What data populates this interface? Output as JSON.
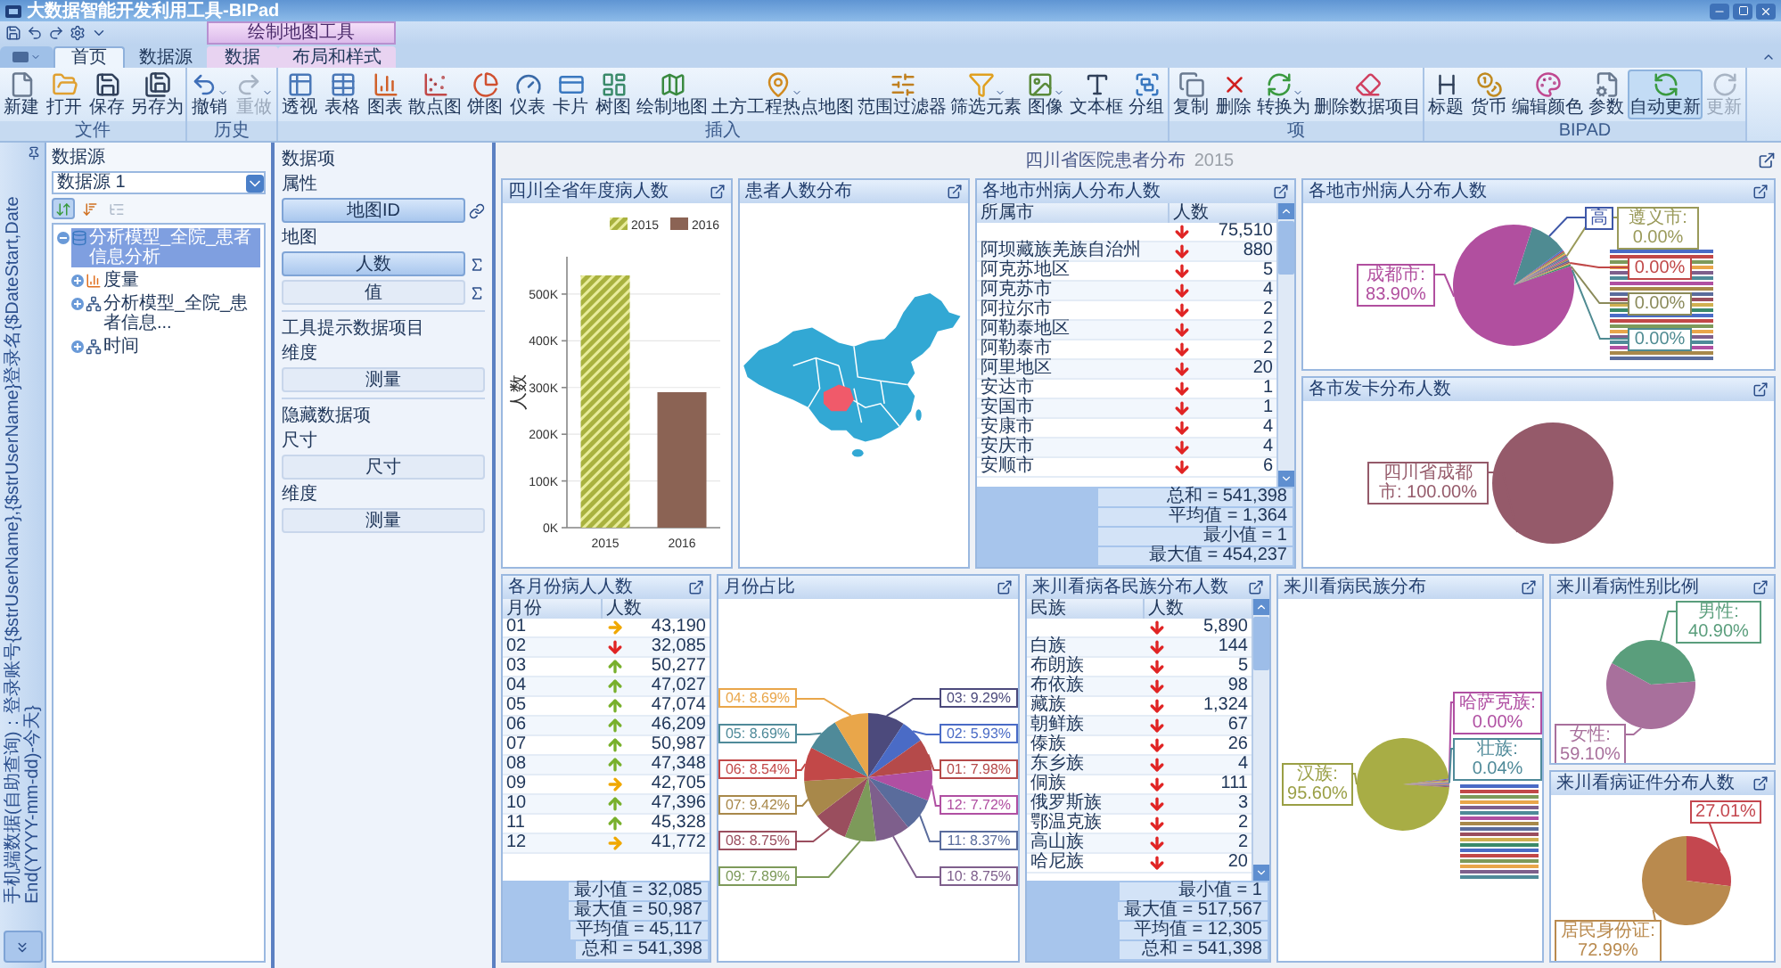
{
  "window": {
    "title": "大数据智能开发利用工具-BIPad"
  },
  "contextual_group": {
    "label": "绘制地图工具"
  },
  "tabs": [
    {
      "label": "首页",
      "selected": true,
      "contextual": false
    },
    {
      "label": "数据源",
      "selected": false,
      "contextual": false
    },
    {
      "label": "数据",
      "selected": false,
      "contextual": true
    },
    {
      "label": "布局和样式",
      "selected": false,
      "contextual": true
    }
  ],
  "ribbon": [
    {
      "label": "文件",
      "buttons": [
        {
          "label": "新建",
          "disabled": false,
          "on": false,
          "menu": false
        },
        {
          "label": "打开",
          "disabled": false,
          "on": false,
          "menu": false
        },
        {
          "label": "保存",
          "disabled": false,
          "on": false,
          "menu": false
        },
        {
          "label": "另存为",
          "disabled": false,
          "on": false,
          "menu": false
        }
      ]
    },
    {
      "label": "历史",
      "buttons": [
        {
          "label": "撤销",
          "disabled": false,
          "on": false,
          "menu": true
        },
        {
          "label": "重做",
          "disabled": true,
          "on": false,
          "menu": true
        }
      ]
    },
    {
      "label": "插入",
      "buttons": [
        {
          "label": "透视",
          "disabled": false,
          "on": false,
          "menu": false
        },
        {
          "label": "表格",
          "disabled": false,
          "on": false,
          "menu": false
        },
        {
          "label": "图表",
          "disabled": false,
          "on": false,
          "menu": false
        },
        {
          "label": "散点图",
          "disabled": false,
          "on": false,
          "menu": false
        },
        {
          "label": "饼图",
          "disabled": false,
          "on": false,
          "menu": false
        },
        {
          "label": "仪表",
          "disabled": false,
          "on": false,
          "menu": false
        },
        {
          "label": "卡片",
          "disabled": false,
          "on": false,
          "menu": false
        },
        {
          "label": "树图",
          "disabled": false,
          "on": false,
          "menu": false
        },
        {
          "label": "绘制地图",
          "disabled": false,
          "on": false,
          "menu": false
        },
        {
          "label": "土方工程热点地图",
          "disabled": false,
          "on": false,
          "menu": true
        },
        {
          "label": "范围过滤器",
          "disabled": false,
          "on": false,
          "menu": false
        },
        {
          "label": "筛选元素",
          "disabled": false,
          "on": false,
          "menu": true
        },
        {
          "label": "图像",
          "disabled": false,
          "on": false,
          "menu": true
        },
        {
          "label": "文本框",
          "disabled": false,
          "on": false,
          "menu": false
        },
        {
          "label": "分组",
          "disabled": false,
          "on": false,
          "menu": false
        }
      ]
    },
    {
      "label": "项",
      "buttons": [
        {
          "label": "复制",
          "disabled": false,
          "on": false,
          "menu": false
        },
        {
          "label": "删除",
          "disabled": false,
          "on": false,
          "menu": false
        },
        {
          "label": "转换为",
          "disabled": false,
          "on": false,
          "menu": true
        },
        {
          "label": "删除数据项目",
          "disabled": false,
          "on": false,
          "menu": false
        }
      ]
    },
    {
      "label": "BIPAD",
      "buttons": [
        {
          "label": "标题",
          "disabled": false,
          "on": false,
          "menu": false
        },
        {
          "label": "货币",
          "disabled": false,
          "on": false,
          "menu": false
        },
        {
          "label": "编辑颜色",
          "disabled": false,
          "on": false,
          "menu": false
        },
        {
          "label": "参数",
          "disabled": false,
          "on": false,
          "menu": false
        },
        {
          "label": "自动更新",
          "disabled": false,
          "on": true,
          "menu": false
        },
        {
          "label": "更新",
          "disabled": true,
          "on": false,
          "menu": false
        }
      ]
    }
  ],
  "side_strip": {
    "text": "手机端数据(自助查询)：登录账号{$strUserName},{$strUserName}登录名{$DateStart,DateEnd(YYYY-mm-dd)-今天}"
  },
  "data_source": {
    "label": "数据源",
    "value": "数据源 1",
    "toolbar": [
      {
        "selected": true,
        "disabled": false
      },
      {
        "selected": false,
        "disabled": false
      },
      {
        "selected": false,
        "disabled": true
      }
    ],
    "tree": [
      {
        "label": "分析模型_全院_患者信息分析",
        "kind": "source",
        "selected": true,
        "expanded": true,
        "children": [
          {
            "label": "度量",
            "kind": "measure",
            "selected": false,
            "expanded": false
          },
          {
            "label": "分析模型_全院_患者信息...",
            "kind": "dimension",
            "selected": false,
            "expanded": false
          },
          {
            "label": "时间",
            "kind": "dimension",
            "selected": false,
            "expanded": false
          }
        ]
      }
    ]
  },
  "data_items": {
    "groups": [
      {
        "title": "数据项",
        "sections": [
          {
            "label": "属性",
            "slots": [
              {
                "label": "地图ID",
                "filled": true,
                "kind": "link"
              }
            ]
          },
          {
            "label": "地图",
            "slots": [
              {
                "label": "人数",
                "filled": true,
                "kind": "sum"
              },
              {
                "label": "值",
                "filled": false,
                "kind": "sum"
              }
            ]
          }
        ]
      },
      {
        "title": "工具提示数据项目",
        "sections": [
          {
            "label": "维度",
            "slots": [
              {
                "label": "测量",
                "filled": false,
                "kind": "plain"
              }
            ]
          }
        ]
      },
      {
        "title": "隐藏数据项",
        "sections": [
          {
            "label": "尺寸",
            "slots": [
              {
                "label": "尺寸",
                "filled": false,
                "kind": "plain"
              }
            ]
          },
          {
            "label": "维度",
            "slots": [
              {
                "label": "测量",
                "filled": false,
                "kind": "plain"
              }
            ]
          }
        ]
      }
    ]
  },
  "dashboard": {
    "title": "四川省医院患者分布",
    "subtitle": "2015",
    "rows": [
      {
        "columns": [
          [
            {
              "kind": "chart",
              "title": "四川全省年度病人数",
              "chart_data": {
                "type": "bar",
                "categories": [
                  "2015",
                  "2016"
                ],
                "ylabel": "人数",
                "ylim": [
                  0,
                  580000
                ],
                "grid": true,
                "legend": "top",
                "yticks": [
                  {
                    "value": 0,
                    "label": "0K"
                  },
                  {
                    "value": 100000,
                    "label": "100K"
                  },
                  {
                    "value": 200000,
                    "label": "200K"
                  },
                  {
                    "value": 300000,
                    "label": "300K"
                  },
                  {
                    "value": 400000,
                    "label": "400K"
                  },
                  {
                    "value": 500000,
                    "label": "500K"
                  }
                ],
                "series": [
                  {
                    "name": "2015",
                    "color": "#a9b23f",
                    "values": [
                      540000,
                      null
                    ]
                  },
                  {
                    "name": "2016",
                    "color": "#8b6354",
                    "values": [
                      null,
                      290000
                    ]
                  }
                ]
              }
            }
          ],
          [
            {
              "kind": "map",
              "title": "患者人数分布"
            }
          ],
          [
            {
              "kind": "grid",
              "title": "各地市州病人分布人数",
              "scrollable": true,
              "columns": [
                "所属市",
                "人数"
              ],
              "rows": [
                {
                  "value": "75,510",
                  "kind": "down"
                },
                {
                  "name": "阿坝藏族羌族自治州",
                  "value": "880",
                  "kind": "down"
                },
                {
                  "name": "阿克苏地区",
                  "value": "5",
                  "kind": "down"
                },
                {
                  "name": "阿克苏市",
                  "value": "4",
                  "kind": "down"
                },
                {
                  "name": "阿拉尔市",
                  "value": "2",
                  "kind": "down"
                },
                {
                  "name": "阿勒泰地区",
                  "value": "2",
                  "kind": "down"
                },
                {
                  "name": "阿勒泰市",
                  "value": "2",
                  "kind": "down"
                },
                {
                  "name": "阿里地区",
                  "value": "20",
                  "kind": "down"
                },
                {
                  "name": "安达市",
                  "value": "1",
                  "kind": "down"
                },
                {
                  "name": "安国市",
                  "value": "1",
                  "kind": "down"
                },
                {
                  "name": "安康市",
                  "value": "4",
                  "kind": "down"
                },
                {
                  "name": "安庆市",
                  "value": "4",
                  "kind": "down"
                },
                {
                  "name": "安顺市",
                  "value": "6",
                  "kind": "down"
                }
              ],
              "totals": [
                "总和 = 541,398",
                "平均值 = 1,364",
                "最小值 = 1",
                "最大值 = 454,237"
              ]
            }
          ],
          [
            {
              "kind": "pie_drawing",
              "title": "各地市州病人分布人数",
              "labels": [
                {
                  "text": "成都市: 83.90%",
                  "color": "#b14f9f"
                },
                {
                  "text": "高",
                  "color": "#3f58a8"
                },
                {
                  "text": "遵义市: 0.00%",
                  "color": "#9a9a5a"
                },
                {
                  "text": "0.00%",
                  "color": "#c04848"
                },
                {
                  "text": "0.00%",
                  "color": "#8a8a5a"
                },
                {
                  "text": "0.00%",
                  "color": "#4f8b92"
                }
              ]
            },
            {
              "kind": "chart",
              "title": "各市发卡分布人数",
              "chart_data": {
                "type": "pie",
                "values": [
                  100
                ],
                "colors": [
                  "#955a6a"
                ],
                "value_labels": [
                  "四川省成都市: 100.00%"
                ]
              }
            }
          ]
        ]
      },
      {
        "columns": [
          [
            {
              "kind": "grid",
              "title": "各月份病人人数",
              "scrollable": false,
              "columns": [
                "月份",
                "人数"
              ],
              "rows": [
                {
                  "name": "01",
                  "value": "43,190",
                  "kind": "flat"
                },
                {
                  "name": "02",
                  "value": "32,085",
                  "kind": "down"
                },
                {
                  "name": "03",
                  "value": "50,277",
                  "kind": "up"
                },
                {
                  "name": "04",
                  "value": "47,027",
                  "kind": "up"
                },
                {
                  "name": "05",
                  "value": "47,074",
                  "kind": "up"
                },
                {
                  "name": "06",
                  "value": "46,209",
                  "kind": "up"
                },
                {
                  "name": "07",
                  "value": "50,987",
                  "kind": "up"
                },
                {
                  "name": "08",
                  "value": "47,348",
                  "kind": "up"
                },
                {
                  "name": "09",
                  "value": "42,705",
                  "kind": "flat"
                },
                {
                  "name": "10",
                  "value": "47,396",
                  "kind": "up"
                },
                {
                  "name": "11",
                  "value": "45,328",
                  "kind": "up"
                },
                {
                  "name": "12",
                  "value": "41,772",
                  "kind": "flat"
                }
              ],
              "totals": [
                "最小值 = 32,085",
                "最大值 = 50,987",
                "平均值 = 45,117",
                "总和 = 541,398"
              ]
            }
          ],
          [
            {
              "kind": "chart",
              "title": "月份占比",
              "chart_data": {
                "type": "pie",
                "values": [
                  7.98,
                  5.93,
                  9.29,
                  8.69,
                  8.69,
                  8.54,
                  9.42,
                  8.75,
                  7.89,
                  8.75,
                  8.37,
                  7.72
                ],
                "colors": [
                  "#b54a4a",
                  "#4a6bc6",
                  "#4c4a7c",
                  "#e9a64a",
                  "#4f8a99",
                  "#c24848",
                  "#a8884a",
                  "#9a4e5e",
                  "#7d9a5a",
                  "#7e5f8c",
                  "#5a6c9c",
                  "#b04fa2"
                ],
                "value_labels": [
                  "01: 7.98%",
                  "02: 5.93%",
                  "03: 9.29%",
                  "04: 8.69%",
                  "05: 8.69%",
                  "06: 8.54%",
                  "07: 9.42%",
                  "08: 8.75%",
                  "09: 7.89%",
                  "10: 8.75%",
                  "11: 8.37%",
                  "12: 7.72%"
                ]
              }
            }
          ],
          [
            {
              "kind": "grid",
              "title": "来川看病各民族分布人数",
              "scrollable": true,
              "columns": [
                "民族",
                "人数"
              ],
              "rows": [
                {
                  "value": "5,890",
                  "kind": "down"
                },
                {
                  "name": "白族",
                  "value": "144",
                  "kind": "down"
                },
                {
                  "name": "布朗族",
                  "value": "5",
                  "kind": "down"
                },
                {
                  "name": "布依族",
                  "value": "98",
                  "kind": "down"
                },
                {
                  "name": "藏族",
                  "value": "1,324",
                  "kind": "down"
                },
                {
                  "name": "朝鲜族",
                  "value": "67",
                  "kind": "down"
                },
                {
                  "name": "傣族",
                  "value": "26",
                  "kind": "down"
                },
                {
                  "name": "东乡族",
                  "value": "4",
                  "kind": "down"
                },
                {
                  "name": "侗族",
                  "value": "111",
                  "kind": "down"
                },
                {
                  "name": "俄罗斯族",
                  "value": "3",
                  "kind": "down"
                },
                {
                  "name": "鄂温克族",
                  "value": "2",
                  "kind": "down"
                },
                {
                  "name": "高山族",
                  "value": "2",
                  "kind": "down"
                },
                {
                  "name": "哈尼族",
                  "value": "20",
                  "kind": "down"
                }
              ],
              "totals": [
                "最小值 = 1",
                "最大值 = 517,567",
                "平均值 = 12,305",
                "总和 = 541,398"
              ]
            }
          ],
          [
            {
              "kind": "pie_drawing",
              "title": "来川看病民族分布",
              "labels": [
                {
                  "text": "汉族: 95.60%",
                  "color": "#9a9f45"
                },
                {
                  "text": "哈萨克族: 0.00%",
                  "color": "#b04fa2"
                },
                {
                  "text": "壮族: 0.04%",
                  "color": "#4f8a99"
                }
              ]
            }
          ],
          [
            {
              "kind": "chart",
              "title": "来川看病性别比例",
              "chart_data": {
                "type": "pie",
                "values": [
                  40.9,
                  59.1
                ],
                "colors": [
                  "#5a9e7c",
                  "#a8709c"
                ],
                "value_labels": [
                  "男性: 40.90%",
                  "女性: 59.10%"
                ]
              }
            },
            {
              "kind": "chart",
              "title": "来川看病证件分布人数",
              "chart_data": {
                "type": "pie",
                "values": [
                  27.01,
                  72.99
                ],
                "colors": [
                  "#c4474f",
                  "#b98a4e"
                ],
                "value_labels": [
                  "27.01%",
                  "居民身份证: 72.99%"
                ]
              }
            }
          ]
        ]
      }
    ]
  }
}
